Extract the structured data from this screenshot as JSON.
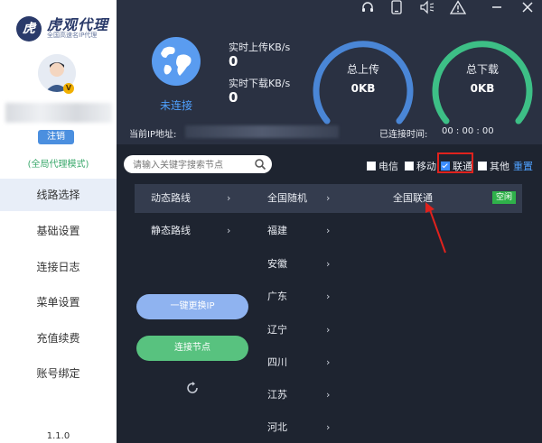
{
  "app": {
    "logo_title": "虎观代理",
    "logo_subtitle": "全国高速名IP代理",
    "logo_mark": "虎",
    "version": "1.1.0"
  },
  "user": {
    "vip_badge": "V",
    "logout_label": "注销",
    "mode": "(全局代理模式)"
  },
  "sidebar": {
    "items": [
      {
        "label": "线路选择",
        "active": true
      },
      {
        "label": "基础设置"
      },
      {
        "label": "连接日志"
      },
      {
        "label": "菜单设置"
      },
      {
        "label": "充值续费"
      },
      {
        "label": "账号绑定"
      }
    ]
  },
  "window_icons": [
    "headset-icon",
    "device-icon",
    "volume-icon",
    "warning-icon",
    "minimize-icon",
    "close-icon"
  ],
  "status": {
    "connection_state": "未连接",
    "upload_label": "实时上传KB/s",
    "upload_value": "0",
    "download_label": "实时下载KB/s",
    "download_value": "0",
    "total_upload_label": "总上传",
    "total_upload_value": "0KB",
    "total_download_label": "总下载",
    "total_download_value": "0KB",
    "current_ip_label": "当前IP地址:",
    "connected_time_label": "已连接时间:",
    "connected_time_value": "00 : 00 : 00"
  },
  "search": {
    "placeholder": "请输入关键字搜索节点"
  },
  "filters": {
    "options": [
      {
        "label": "电信",
        "checked": false
      },
      {
        "label": "移动",
        "checked": false
      },
      {
        "label": "联通",
        "checked": true
      },
      {
        "label": "其他",
        "checked": false
      }
    ],
    "reset_label": "重置"
  },
  "routes": {
    "types": [
      {
        "label": "动态路线",
        "active": true
      },
      {
        "label": "静态路线"
      }
    ],
    "regions": [
      "全国随机",
      "福建",
      "安徽",
      "广东",
      "辽宁",
      "四川",
      "江苏",
      "河北"
    ],
    "nodes": [
      {
        "label": "全国联通",
        "status": "空闲"
      }
    ]
  },
  "actions": {
    "switch_ip": "一键更换IP",
    "connect_node": "连接节点"
  },
  "colors": {
    "accent_blue": "#4fa1ff",
    "gauge_blue": "#4a86d6",
    "gauge_green": "#3dbf86",
    "highlight_red": "#e0221d",
    "idle_green": "#2fb14a"
  }
}
